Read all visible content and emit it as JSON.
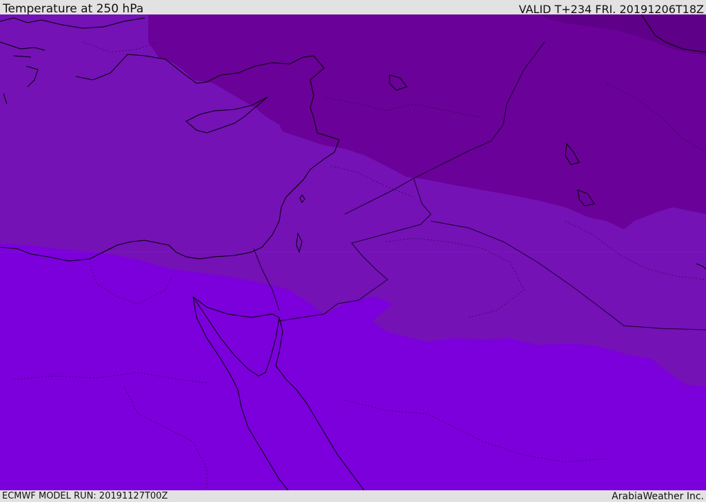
{
  "header": {
    "title": "Temperature at 250 hPa",
    "valid": "VALID T+234 FRI. 20191206T18Z"
  },
  "footer": {
    "model_run": "ECMWF MODEL RUN: 20191127T00Z",
    "credit": "ArabiaWeather Inc."
  },
  "colors": {
    "band_warmest": "#7b00db",
    "band_mid": "#7412b5",
    "band_cold": "#6a0198",
    "band_coldest": "#5e0088",
    "coastline": "#000000",
    "border": "#1a0030",
    "top_bar_bg": "#e2e2e2"
  }
}
